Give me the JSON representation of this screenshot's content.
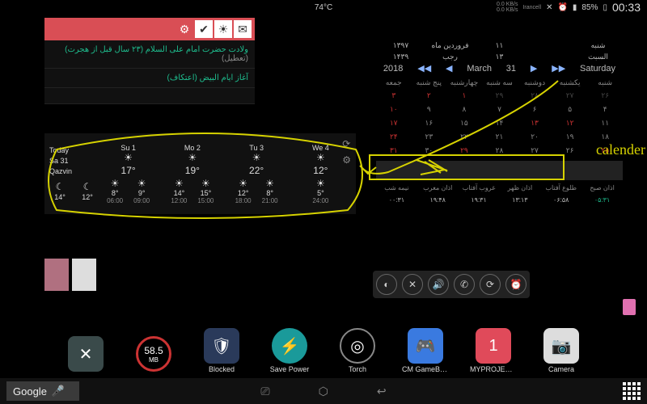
{
  "status": {
    "temp": "74°C",
    "net1": "0.0 KB/s",
    "net2": "0.0 KB/s",
    "carrier": "Irancell",
    "battery": "85%",
    "time": "00:33"
  },
  "events": {
    "items": [
      {
        "text": "ولادت حضرت امام علی السلام (۲۳ سال قبل از هجرت)",
        "extra": "(تعطیل)"
      },
      {
        "text": "آغاز ایام البیض (اعتکاف)"
      }
    ]
  },
  "calendar": {
    "hdr": {
      "y1": "۱۳۹۷",
      "m1": "فروردین ماه",
      "d1": "۱۱",
      "wd1": "شنبه",
      "y2": "۱۴۳۹",
      "m2": "رجب",
      "d2": "۱۳",
      "wd2": "السبت",
      "y3": "2018",
      "m3": "March",
      "d3": "31",
      "wd3": "Saturday"
    },
    "dow": [
      "جمعه",
      "پنج شنبه",
      "چهارشنبه",
      "سه شنبه",
      "دوشنبه",
      "یکشنبه",
      "شنبه"
    ],
    "weeks": [
      [
        {
          "v": "۳",
          "c": "r"
        },
        {
          "v": "۲",
          "c": "r"
        },
        {
          "v": "۱",
          "c": "r"
        },
        {
          "v": "۲۹",
          "c": "dim"
        },
        {
          "v": "۲۸",
          "c": "dim"
        },
        {
          "v": "۲۷",
          "c": "dim"
        },
        {
          "v": "۲۶",
          "c": "dim"
        }
      ],
      [
        {
          "v": "۱۰",
          "c": "r"
        },
        {
          "v": "۹",
          "c": ""
        },
        {
          "v": "۸",
          "c": ""
        },
        {
          "v": "۷",
          "c": ""
        },
        {
          "v": "۶",
          "c": ""
        },
        {
          "v": "۵",
          "c": ""
        },
        {
          "v": "۴",
          "c": ""
        }
      ],
      [
        {
          "v": "۱۷",
          "c": "r"
        },
        {
          "v": "۱۶",
          "c": ""
        },
        {
          "v": "۱۵",
          "c": ""
        },
        {
          "v": "۱۴",
          "c": ""
        },
        {
          "v": "۱۳",
          "c": "r"
        },
        {
          "v": "۱۲",
          "c": "r"
        },
        {
          "v": "۱۱",
          "c": ""
        }
      ],
      [
        {
          "v": "۲۴",
          "c": "r"
        },
        {
          "v": "۲۳",
          "c": ""
        },
        {
          "v": "۲۲",
          "c": ""
        },
        {
          "v": "۲۱",
          "c": ""
        },
        {
          "v": "۲۰",
          "c": ""
        },
        {
          "v": "۱۹",
          "c": ""
        },
        {
          "v": "۱۸",
          "c": ""
        }
      ],
      [
        {
          "v": "۳۱",
          "c": "r"
        },
        {
          "v": "۳۰",
          "c": ""
        },
        {
          "v": "۲۹",
          "c": "r"
        },
        {
          "v": "۲۸",
          "c": ""
        },
        {
          "v": "۲۷",
          "c": ""
        },
        {
          "v": "۲۶",
          "c": ""
        },
        {
          "v": "۲۵",
          "c": "r"
        }
      ]
    ],
    "pt_labels": [
      "نیمه شب",
      "اذان مغرب",
      "غروب آفتاب",
      "اذان ظهر",
      "طلوع آفتاب",
      "اذان صبح"
    ],
    "pt_values": [
      "۰۰:۳۱",
      "۱۹:۴۸",
      "۱۹:۳۱",
      "۱۳:۱۳",
      "۰۶:۵۸",
      "۰۵:۳۱"
    ]
  },
  "weather": {
    "today": {
      "label": "Today",
      "day": "Sa 31",
      "city": "Qazvin",
      "t1": "14°",
      "t2": "12°"
    },
    "forecast": [
      {
        "day": "Su 1",
        "hi": "17°",
        "pairs": [
          {
            "t": "8°",
            "h": "06:00"
          },
          {
            "t": "9°",
            "h": "09:00"
          }
        ]
      },
      {
        "day": "Mo 2",
        "hi": "19°",
        "pairs": [
          {
            "t": "14°",
            "h": "12:00"
          },
          {
            "t": "15°",
            "h": "15:00"
          }
        ]
      },
      {
        "day": "Tu 3",
        "hi": "22°",
        "pairs": [
          {
            "t": "12°",
            "h": "18:00"
          },
          {
            "t": "8°",
            "h": "21:00"
          }
        ]
      },
      {
        "day": "We 4",
        "hi": "12°",
        "pairs": [
          {
            "t": "5°",
            "h": "24:00"
          }
        ]
      }
    ]
  },
  "annotation": "calender",
  "storage": {
    "value": "58.5",
    "unit": "MB"
  },
  "apps": {
    "close": "",
    "blocked": "Blocked",
    "savepower": "Save Power",
    "torch": "Torch",
    "gamebox": "CM GameBo...",
    "myprojects": "MYPROJECTS",
    "myprojects_badge": "1",
    "camera": "Camera"
  },
  "search": "Google"
}
